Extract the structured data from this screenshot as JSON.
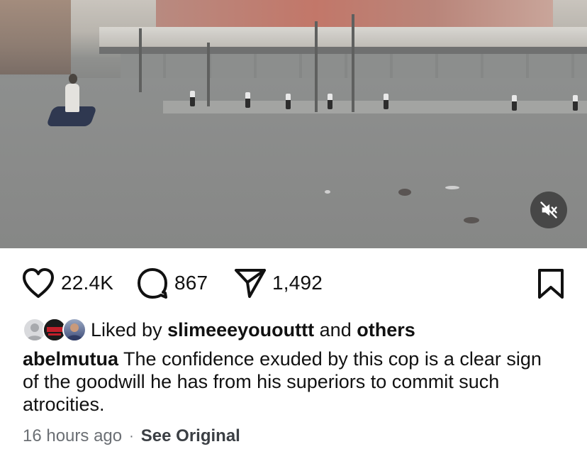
{
  "video": {
    "muted": true,
    "mute_icon": "speaker-muted-icon"
  },
  "actions": {
    "likes": "22.4K",
    "comments": "867",
    "shares": "1,492",
    "icons": [
      "heart-icon",
      "comment-icon",
      "share-icon",
      "bookmark-icon"
    ]
  },
  "liked_by": {
    "prefix": "Liked by",
    "user": "slimeeeyououttt",
    "joiner": "and",
    "others": "others"
  },
  "post": {
    "username": "abelmutua",
    "caption": "The confidence exuded by this cop is a clear sign of the goodwill he has from his superiors to commit such atrocities.",
    "time": "16 hours ago",
    "separator": "·",
    "see_original": "See Original"
  },
  "colors": {
    "text": "#111111",
    "muted_text": "#6b6f74",
    "mute_button_bg": "#3c3c3c"
  }
}
